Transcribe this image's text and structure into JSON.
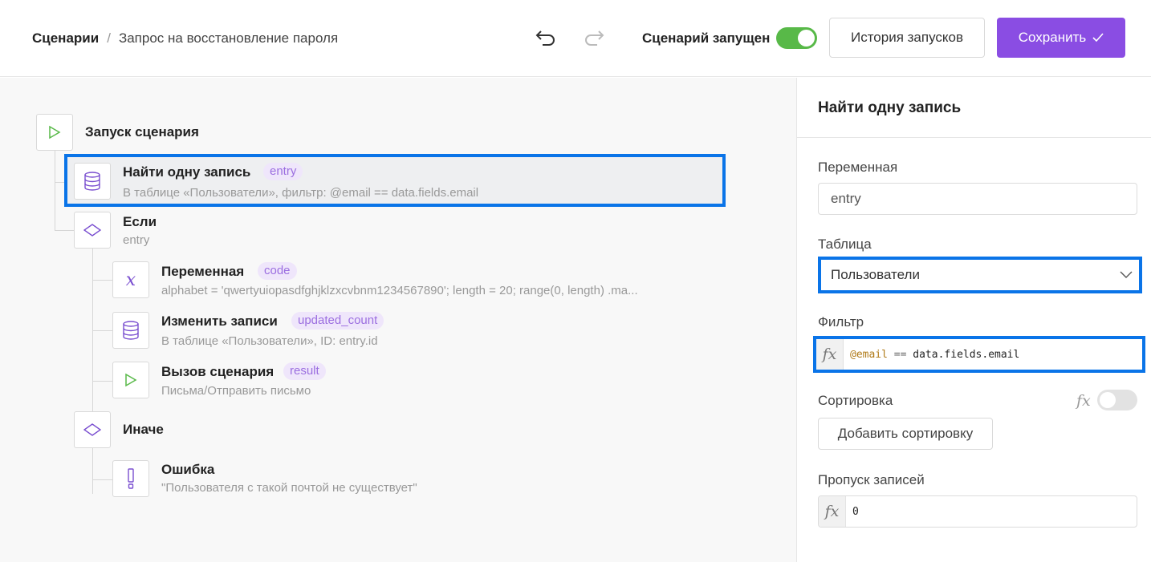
{
  "header": {
    "breadcrumb_root": "Сценарии",
    "breadcrumb_separator": "/",
    "breadcrumb_current": "Запрос на восстановление пароля",
    "run_status_label": "Сценарий запущен",
    "run_toggle_on": true,
    "history_button": "История запусков",
    "save_button": "Сохранить",
    "icons": [
      "undo-icon",
      "redo-icon",
      "check-icon"
    ]
  },
  "flow": {
    "start": {
      "title": "Запуск сценария",
      "icon": "play-icon"
    },
    "find": {
      "title": "Найти одну запись",
      "tag": "entry",
      "subtitle": "В таблице «Пользователи», фильтр: @email == data.fields.email",
      "icon": "database-icon",
      "selected": true
    },
    "if": {
      "title": "Если",
      "subtitle": "entry",
      "icon": "diamond-icon"
    },
    "variable": {
      "title": "Переменная",
      "tag": "code",
      "subtitle": "alphabet = 'qwertyuiopasdfghjklzxcvbnm1234567890'; length = 20; range(0, length) .ma...",
      "icon": "variable-icon"
    },
    "update": {
      "title": "Изменить записи",
      "tag": "updated_count",
      "subtitle": "В таблице «Пользователи», ID: entry.id",
      "icon": "database-icon"
    },
    "call": {
      "title": "Вызов сценария",
      "tag": "result",
      "subtitle": "Письма/Отправить письмо",
      "icon": "play-icon"
    },
    "else": {
      "title": "Иначе",
      "icon": "diamond-icon"
    },
    "error": {
      "title": "Ошибка",
      "subtitle": "\"Пользователя с такой почтой не существует\"",
      "icon": "exclamation-icon"
    }
  },
  "panel": {
    "title": "Найти одну запись",
    "variable_label": "Переменная",
    "variable_value": "entry",
    "table_label": "Таблица",
    "table_value": "Пользователи",
    "filter_label": "Фильтр",
    "filter_fx": "fx",
    "filter_code_var": "@email",
    "filter_code_op": "==",
    "filter_code_value": "data.fields.email",
    "sort_label": "Сортировка",
    "sort_fx": "fx",
    "sort_toggle_on": false,
    "add_sort_button": "Добавить сортировку",
    "skip_label": "Пропуск записей",
    "skip_fx": "fx",
    "skip_value": "0"
  },
  "colors": {
    "accent": "#8a4de3",
    "toggle_on": "#58b948",
    "selection_border": "#0a74e8",
    "tag_bg": "#efe6fb",
    "tag_text": "#9b6ee0"
  }
}
